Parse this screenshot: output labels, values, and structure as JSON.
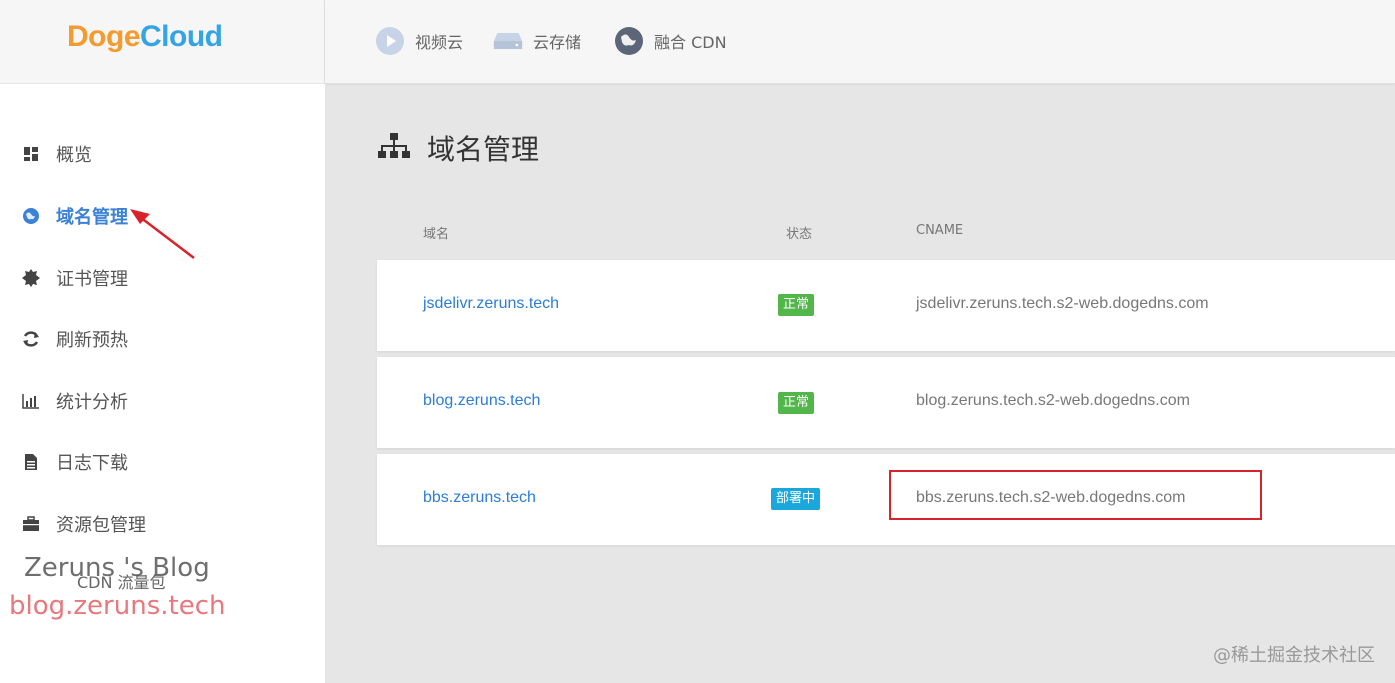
{
  "brand": {
    "logo_part1": "Doge",
    "logo_part2": "Cloud",
    "color_orange": "#f39b2f",
    "color_blue": "#35a4e6"
  },
  "top_nav": [
    {
      "label": "视频云",
      "icon": "play-icon"
    },
    {
      "label": "云存储",
      "icon": "storage-icon"
    },
    {
      "label": "融合 CDN",
      "icon": "globe-icon"
    }
  ],
  "sidebar": {
    "items": [
      {
        "label": "概览",
        "icon": "dashboard-icon"
      },
      {
        "label": "域名管理",
        "icon": "globe-icon",
        "active": true
      },
      {
        "label": "证书管理",
        "icon": "certificate-icon"
      },
      {
        "label": "刷新预热",
        "icon": "refresh-icon"
      },
      {
        "label": "统计分析",
        "icon": "bar-chart-icon"
      },
      {
        "label": "日志下载",
        "icon": "file-icon"
      },
      {
        "label": "资源包管理",
        "icon": "briefcase-icon"
      }
    ],
    "sub_item": "CDN 流量包"
  },
  "main": {
    "title": "域名管理",
    "columns": {
      "domain": "域名",
      "status": "状态",
      "cname": "CNAME"
    },
    "rows": [
      {
        "domain": "jsdelivr.zeruns.tech",
        "status": "正常",
        "cname": "jsdelivr.zeruns.tech.s2-web.dogedns.com"
      },
      {
        "domain": "blog.zeruns.tech",
        "status": "正常",
        "cname": "blog.zeruns.tech.s2-web.dogedns.com"
      },
      {
        "domain": "bbs.zeruns.tech",
        "status": "部署中",
        "cname": "bbs.zeruns.tech.s2-web.dogedns.com"
      }
    ],
    "status_colors": {
      "ok": "#52b64b",
      "deploying": "#1aa8dc"
    }
  },
  "watermark": {
    "line1": "Zeruns 's Blog",
    "line2": "blog.zeruns.tech"
  },
  "footer_credit": "@稀土掘金技术社区"
}
